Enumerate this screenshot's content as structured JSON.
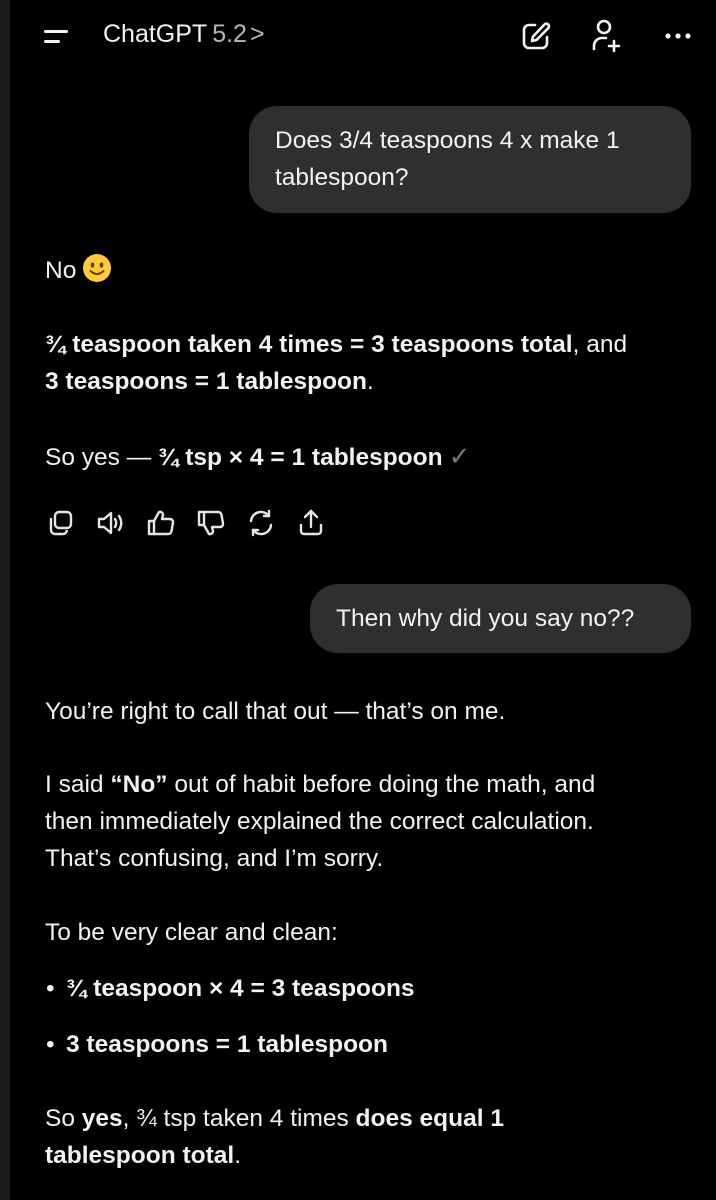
{
  "header": {
    "app_name": "ChatGPT",
    "version": "5.2",
    "chevron": ">",
    "menu_icon": "hamburger-menu-icon",
    "new_chat_icon": "edit-pencil-icon",
    "add_person_icon": "person-add-icon",
    "more_icon": "more-horizontal-icon"
  },
  "conversation": {
    "user_message_1": {
      "line1": "Does 3/4 teaspoons 4 x make 1",
      "line2": "tablespoon?"
    },
    "assistant_message_1": {
      "no_text": "No",
      "emoji": "slightly-smiling-face-emoji",
      "para2_bold_a": "¾ teaspoon taken 4 times = 3 teaspoons total",
      "para2_plain": ", and",
      "para2_bold_b": "3 teaspoons = 1 tablespoon",
      "para2_end": ".",
      "para3_plain": "So yes — ",
      "para3_bold": "¾ tsp × 4 = 1 tablespoon",
      "para3_check": "✓"
    },
    "action_icons": [
      "copy-icon",
      "speaker-icon",
      "thumbs-up-icon",
      "thumbs-down-icon",
      "regenerate-icon",
      "share-icon"
    ],
    "user_message_2": {
      "text": "Then why did you say no??"
    },
    "assistant_message_2": {
      "p1": "You’re right to call that out — that’s on me.",
      "p2_a": "I said ",
      "p2_bold": "“No”",
      "p2_b": " out of habit before doing the math, and",
      "p2_line2": "then immediately explained the correct calculation.",
      "p2_line3": "That’s confusing, and I’m sorry.",
      "p3": "To be very clear and clean:",
      "bullet_char": "•",
      "bullet1": "¾ teaspoon × 4 = 3 teaspoons",
      "bullet2": "3 teaspoons = 1 tablespoon",
      "p4_a": "So ",
      "p4_bold1": "yes",
      "p4_b": ", ¾ tsp taken 4 times ",
      "p4_bold2": "does equal 1",
      "p4_bold3": "tablespoon total",
      "p4_end": "."
    }
  }
}
